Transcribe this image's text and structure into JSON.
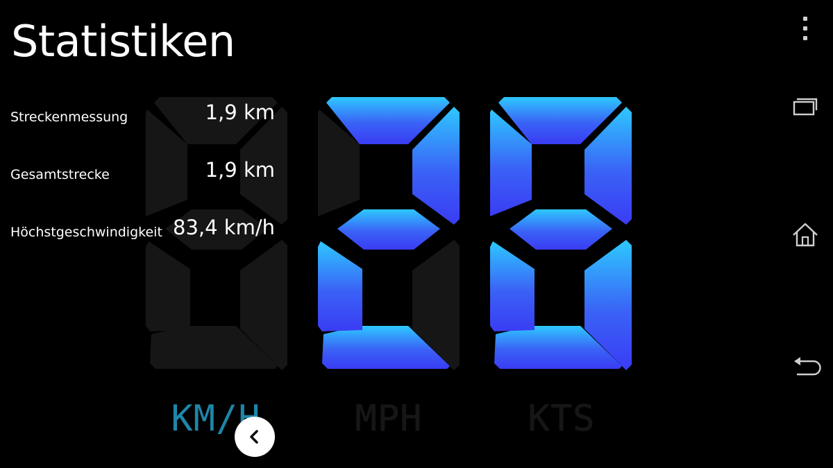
{
  "header": {
    "title": "Statistiken"
  },
  "stats": [
    {
      "label": "Streckenmessung",
      "value": "1,9 km"
    },
    {
      "label": "Gesamtstrecke",
      "value": "1,9 km"
    },
    {
      "label": "Höchstgeschwindigkeit",
      "value": "83,4 km/h"
    }
  ],
  "speed_display": {
    "digits": [
      "",
      "2",
      "8"
    ],
    "active_color_top": "#2ec8ff",
    "active_color_bottom": "#3a3cf4",
    "inactive_color": "#161616"
  },
  "units": [
    {
      "label": "KM/H",
      "active": true
    },
    {
      "label": "MPH",
      "active": false
    },
    {
      "label": "KTS",
      "active": false
    }
  ],
  "icons": {
    "menu": "overflow-menu-icon",
    "recents": "recent-apps-icon",
    "home": "home-icon",
    "back": "back-arrow-icon",
    "fab": "chevron-left-icon"
  },
  "colors": {
    "background": "#000000",
    "unit_active": "#1e86a8",
    "unit_inactive": "#161616"
  }
}
